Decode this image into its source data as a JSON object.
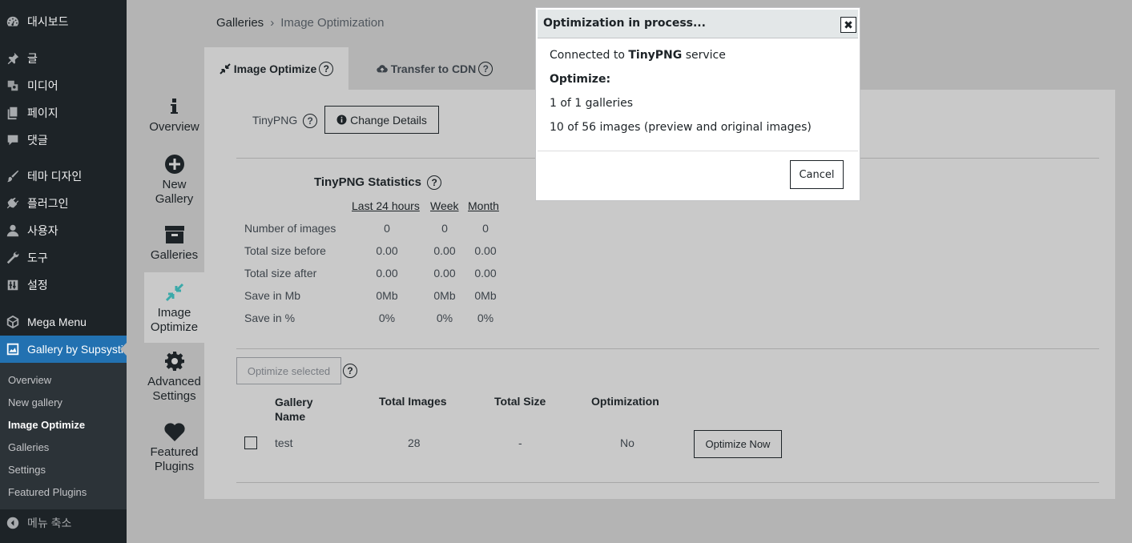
{
  "sidebar": {
    "items": [
      {
        "label": "대시보드",
        "icon": "dashboard-icon"
      },
      {
        "label": "글",
        "icon": "pin-icon"
      },
      {
        "label": "미디어",
        "icon": "media-icon"
      },
      {
        "label": "페이지",
        "icon": "page-icon"
      },
      {
        "label": "댓글",
        "icon": "comment-icon"
      },
      {
        "label": "테마 디자인",
        "icon": "brush-icon"
      },
      {
        "label": "플러그인",
        "icon": "plugin-icon"
      },
      {
        "label": "사용자",
        "icon": "user-icon"
      },
      {
        "label": "도구",
        "icon": "wrench-icon"
      },
      {
        "label": "설정",
        "icon": "settings-icon"
      },
      {
        "label": "Mega Menu",
        "icon": "cube-icon"
      },
      {
        "label": "Gallery by Supsystic",
        "icon": "gallery-icon"
      }
    ],
    "submenu": [
      "Overview",
      "New gallery",
      "Image Optimize",
      "Galleries",
      "Settings",
      "Featured Plugins"
    ],
    "collapse_label": "메뉴 축소"
  },
  "breadcrumb": {
    "parent": "Galleries",
    "separator": "›",
    "current": "Image Optimization"
  },
  "tabs": [
    {
      "label": "Image Optimize",
      "help": "?"
    },
    {
      "label": "Transfer to CDN",
      "help": "?"
    }
  ],
  "vnav": [
    {
      "label_line1": "Overview",
      "label_line2": ""
    },
    {
      "label_line1": "New",
      "label_line2": "Gallery"
    },
    {
      "label_line1": "Galleries",
      "label_line2": ""
    },
    {
      "label_line1": "Image",
      "label_line2": "Optimize"
    },
    {
      "label_line1": "Advanced",
      "label_line2": "Settings"
    },
    {
      "label_line1": "Featured",
      "label_line2": "Plugins"
    }
  ],
  "service": {
    "label": "TinyPNG",
    "help": "?",
    "change_button": "Change Details"
  },
  "stats": {
    "title": "TinyPNG Statistics",
    "help": "?",
    "columns": [
      "Last 24 hours",
      "Week",
      "Month"
    ],
    "rows": [
      {
        "label": "Number of images",
        "values": [
          "0",
          "0",
          "0"
        ]
      },
      {
        "label": "Total size before",
        "values": [
          "0.00",
          "0.00",
          "0.00"
        ]
      },
      {
        "label": "Total size after",
        "values": [
          "0.00",
          "0.00",
          "0.00"
        ]
      },
      {
        "label": "Save in Mb",
        "values": [
          "0Mb",
          "0Mb",
          "0Mb"
        ]
      },
      {
        "label": "Save in %",
        "values": [
          "0%",
          "0%",
          "0%"
        ]
      }
    ]
  },
  "table": {
    "optimize_selected": "Optimize selected",
    "help": "?",
    "headers": {
      "name_line1": "Gallery",
      "name_line2": "Name",
      "total_images": "Total Images",
      "total_size": "Total Size",
      "optimization": "Optimization"
    },
    "rows": [
      {
        "name": "test",
        "total_images": "28",
        "total_size": "-",
        "optimization": "No",
        "action": "Optimize Now"
      }
    ]
  },
  "modal": {
    "title": "Optimization in process...",
    "close": "✖",
    "line1_prefix": "Connected to ",
    "line1_service": "TinyPNG",
    "line1_suffix": " service",
    "optimize_label": "Optimize:",
    "galleries_progress": "1 of 1 galleries",
    "images_progress": "10 of 56 images (preview and original images)",
    "cancel": "Cancel"
  },
  "colors": {
    "sidebar_bg": "#1d2327",
    "active_menu": "#2271b1",
    "accent_teal": "#3ba9a9",
    "overlay_bg": "#b4b4b4"
  }
}
